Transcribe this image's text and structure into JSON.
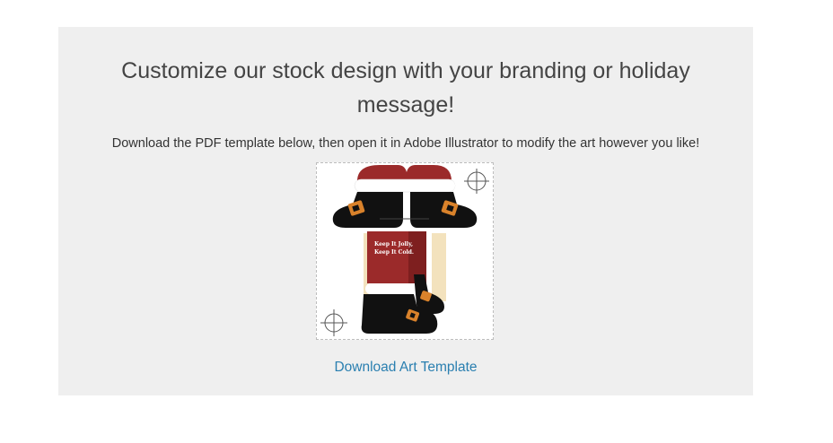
{
  "section": {
    "heading": "Customize our stock design with your branding or holiday message!",
    "subtext": "Download the PDF template below, then open it in Adobe Illustrator to modify the art however you like!",
    "template_art": {
      "line1": "Keep It Jolly,",
      "line2": "Keep It Cold."
    },
    "download_link": "Download Art Template"
  },
  "colors": {
    "panel_bg": "#efefef",
    "link": "#2a7fb0",
    "santa_red": "#9b2a2a",
    "boot_black": "#111111",
    "buckle_orange": "#d9822b",
    "fur_white": "#ffffff",
    "tan": "#f3e2bd"
  }
}
